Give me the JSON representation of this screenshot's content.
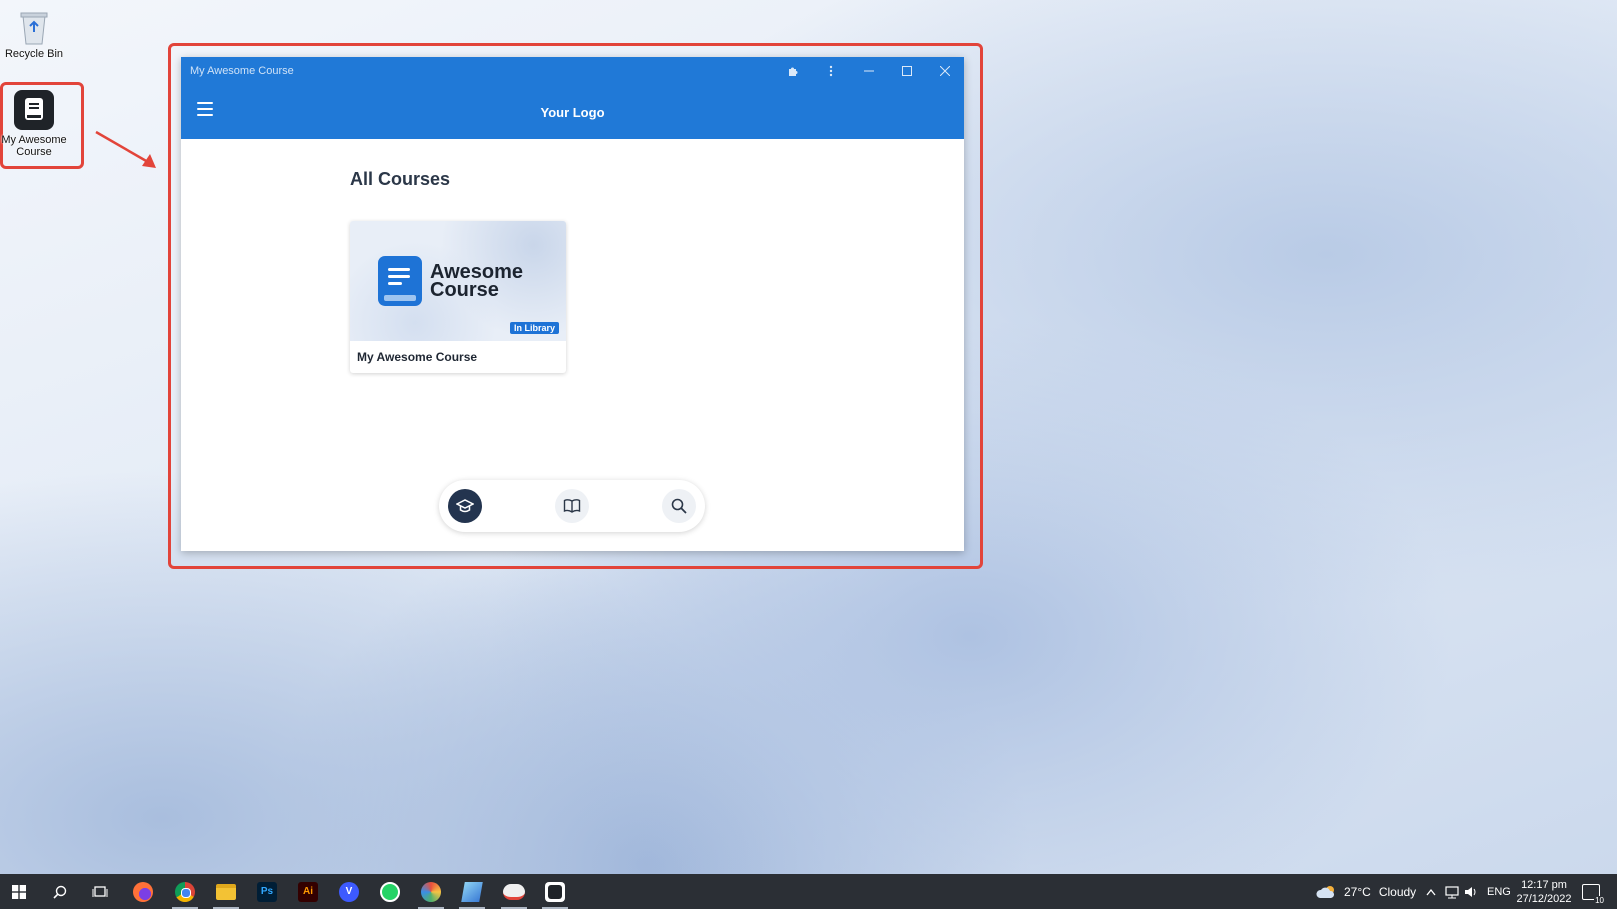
{
  "desktop": {
    "icons": [
      {
        "label": "Recycle Bin"
      },
      {
        "label": "My Awesome Course"
      }
    ]
  },
  "window": {
    "title": "My Awesome Course",
    "logo_text": "Your Logo",
    "page_title": "All Courses",
    "course": {
      "brand_line1": "Awesome",
      "brand_line2": "Course",
      "badge": "In Library",
      "title": "My Awesome Course"
    },
    "bottom_nav": [
      "graduation-cap-icon",
      "book-open-icon",
      "search-icon"
    ]
  },
  "taskbar": {
    "apps": [
      "start",
      "search",
      "task-view",
      "firefox",
      "chrome",
      "file-explorer",
      "Ps",
      "Ai",
      "V",
      "whatsapp",
      "app-a",
      "app-b",
      "app-c",
      "my-awesome-course"
    ],
    "weather": {
      "temp": "27°C",
      "condition": "Cloudy"
    },
    "language": "ENG",
    "time": "12:17 pm",
    "date": "27/12/2022",
    "notifications": "10"
  },
  "colors": {
    "accent": "#2079d7",
    "annotation": "#e2443a",
    "nav_active": "#23344f"
  }
}
